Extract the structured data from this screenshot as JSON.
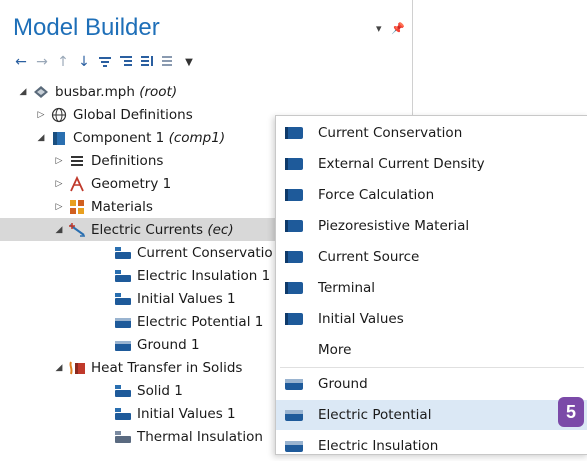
{
  "panel": {
    "title": "Model Builder",
    "toolbar_icons": [
      "arrow-left-icon",
      "arrow-right-icon",
      "arrow-up-icon",
      "arrow-down-icon",
      "show-icon",
      "collapse-icon",
      "expand-icon",
      "list-icon",
      "dropdown-icon"
    ]
  },
  "tree": {
    "root": {
      "name": "busbar.mph",
      "suffix": "(root)"
    },
    "global": "Global Definitions",
    "component": {
      "name": "Component 1",
      "suffix": "(comp1)"
    },
    "definitions": "Definitions",
    "geometry": "Geometry 1",
    "materials": "Materials",
    "electric_currents": {
      "name": "Electric Currents",
      "suffix": "(ec)"
    },
    "ec_children": [
      "Current Conservatio",
      "Electric Insulation 1",
      "Initial Values 1",
      "Electric Potential 1",
      "Ground 1"
    ],
    "heat_transfer": "Heat Transfer in Solids",
    "ht_children": [
      "Solid 1",
      "Initial Values 1",
      "Thermal Insulation"
    ]
  },
  "menu": {
    "items": [
      "Current Conservation",
      "External Current Density",
      "Force Calculation",
      "Piezoresistive Material",
      "Current Source",
      "Terminal",
      "Initial Values",
      "More",
      "Ground",
      "Electric Potential",
      "Electric Insulation"
    ],
    "highlighted": "Electric Potential"
  },
  "badge": "5",
  "colors": {
    "title": "#1e6fb8",
    "selected_row": "#d8d8d8",
    "highlight": "#dbe8f5",
    "badge": "#7b4aa8"
  }
}
